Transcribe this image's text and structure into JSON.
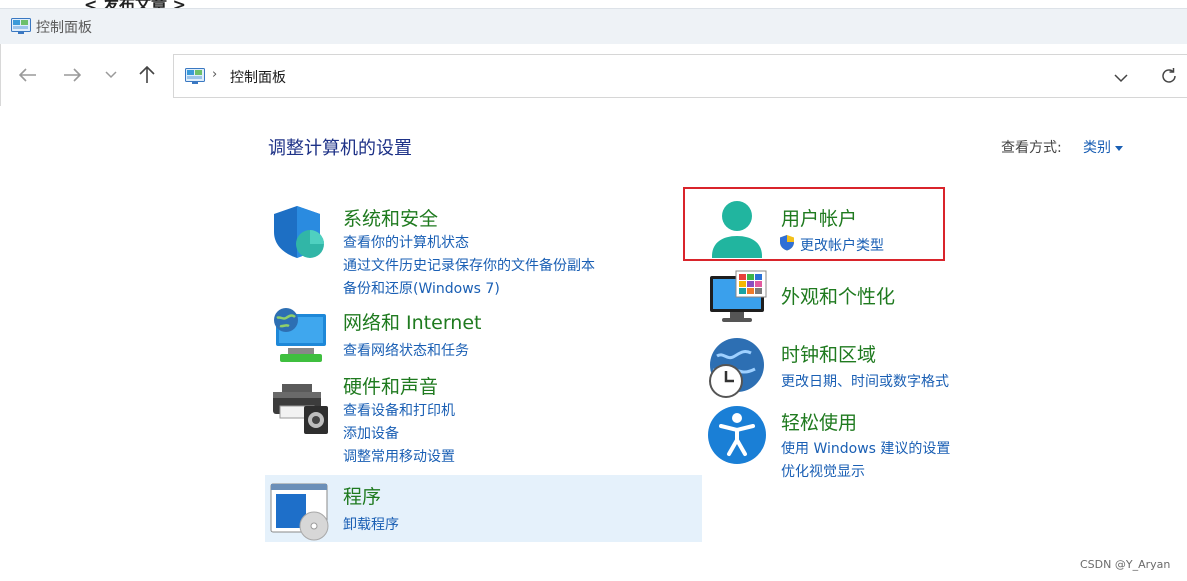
{
  "top_fragment": "< 发布文章 >",
  "window": {
    "title": "控制面板"
  },
  "address": {
    "breadcrumb": "控制面板",
    "separator": "›"
  },
  "header": {
    "title": "调整计算机的设置",
    "view_label": "查看方式:",
    "view_value": "类别"
  },
  "categories": {
    "system": {
      "title": "系统和安全",
      "links": [
        "查看你的计算机状态",
        "通过文件历史记录保存你的文件备份副本",
        "备份和还原(Windows 7)"
      ]
    },
    "network": {
      "title": "网络和 Internet",
      "links": [
        "查看网络状态和任务"
      ]
    },
    "hardware": {
      "title": "硬件和声音",
      "links": [
        "查看设备和打印机",
        "添加设备",
        "调整常用移动设置"
      ]
    },
    "programs": {
      "title": "程序",
      "links": [
        "卸载程序"
      ]
    },
    "accounts": {
      "title": "用户帐户",
      "links": [
        "更改帐户类型"
      ]
    },
    "appearance": {
      "title": "外观和个性化",
      "links": []
    },
    "clock": {
      "title": "时钟和区域",
      "links": [
        "更改日期、时间或数字格式"
      ]
    },
    "ease": {
      "title": "轻松使用",
      "links": [
        "使用 Windows 建议的设置",
        "优化视觉显示"
      ]
    }
  },
  "watermark": "CSDN @Y_Aryan",
  "colors": {
    "category_title": "#1f7a1f",
    "link": "#1a5fb4",
    "page_title": "#1e3287",
    "highlight": "#e5f1fb",
    "annotation_box": "#d9242b"
  }
}
